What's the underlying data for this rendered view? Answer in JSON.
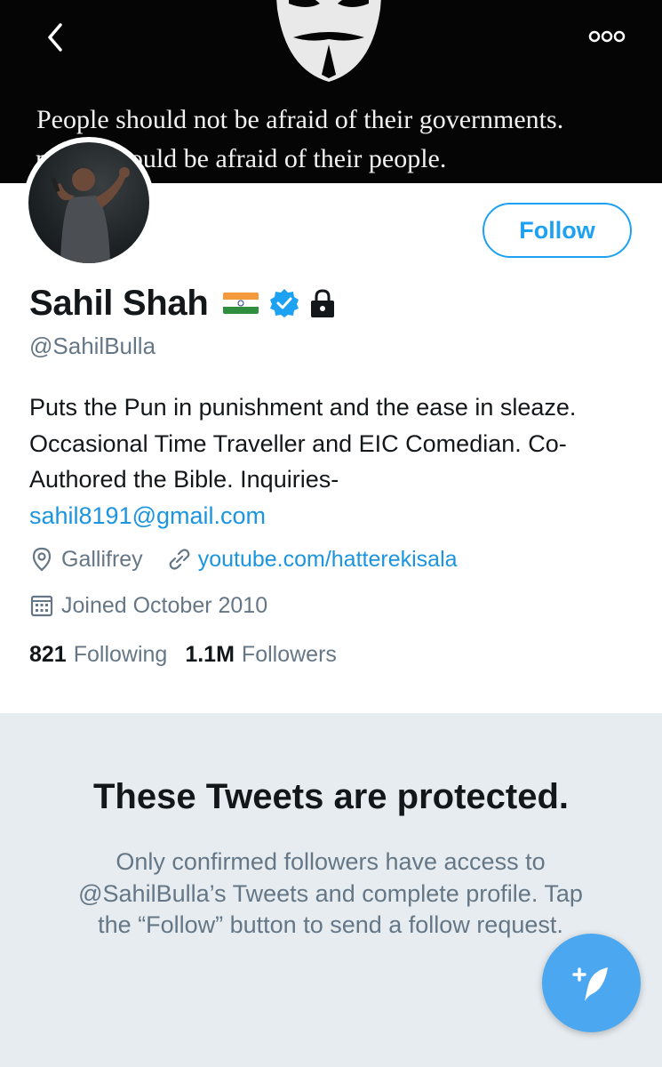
{
  "banner": {
    "quote_line_1": "People should not be afraid of their governments.",
    "quote_line_2": "ments should be afraid of their people."
  },
  "profile": {
    "name": "Sahil Shah",
    "handle": "@SahilBulla",
    "bio": "Puts the Pun in punishment and the ease in sleaze. Occasional Time Traveller and EIC Comedian. Co- Authored the Bible. Inquiries-",
    "bio_link": "sahil8191@gmail.com",
    "location": "Gallifrey",
    "website": "youtube.com/hatterekisala",
    "joined": "Joined October 2010",
    "following_count": "821",
    "following_label": "Following",
    "followers_count": "1.1M",
    "followers_label": "Followers"
  },
  "follow_button": {
    "label": "Follow"
  },
  "protected": {
    "title": "These Tweets are protected.",
    "message": "Only confirmed followers have access to @SahilBulla’s Tweets and complete profile. Tap the “Follow” button to send a follow request."
  },
  "icons": {
    "back": "chevron-left-icon",
    "more": "more-icon",
    "verified": "verified-icon",
    "lock": "lock-icon",
    "location": "location-icon",
    "link": "link-icon",
    "calendar": "calendar-icon",
    "compose": "compose-tweet-icon"
  },
  "colors": {
    "accent": "#1da1f2",
    "link": "#1b95e0",
    "secondary_text": "#657786",
    "protected_bg": "#e6ecf0"
  }
}
